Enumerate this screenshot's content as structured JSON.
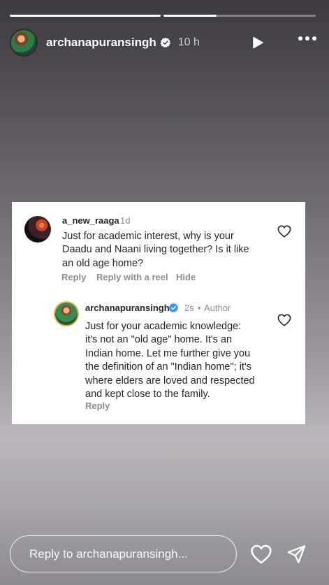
{
  "story": {
    "username": "archanapuransingh",
    "time": "10 h",
    "progress": [
      1,
      0.45
    ]
  },
  "card": {
    "comment": {
      "username": "a_new_raaga",
      "time": "1d",
      "text_lines": [
        "Just for academic interest, why is your",
        "Daadu and Naani living together? Is it like",
        "an old age home?"
      ],
      "actions": [
        "Reply",
        "Reply with a reel",
        "Hide"
      ]
    },
    "reply": {
      "username": "archanapuransingh",
      "time": "2s",
      "author_label": "Author",
      "text_lines": [
        "Just for your academic knowledge:",
        "it's not an \"old age\" home. It's an",
        "Indian home. Let me further give you",
        "the definition of an \"Indian home\"; it's",
        "where elders are loved and respected",
        "and kept close to the family."
      ],
      "action": "Reply"
    }
  },
  "footer": {
    "reply_placeholder": "Reply to archanapuransingh..."
  },
  "icons": {
    "verified_color": "#3897f0",
    "like": "heart-outline-icon",
    "send": "paper-plane-icon",
    "play": "play-icon",
    "more": "ellipsis-icon"
  }
}
